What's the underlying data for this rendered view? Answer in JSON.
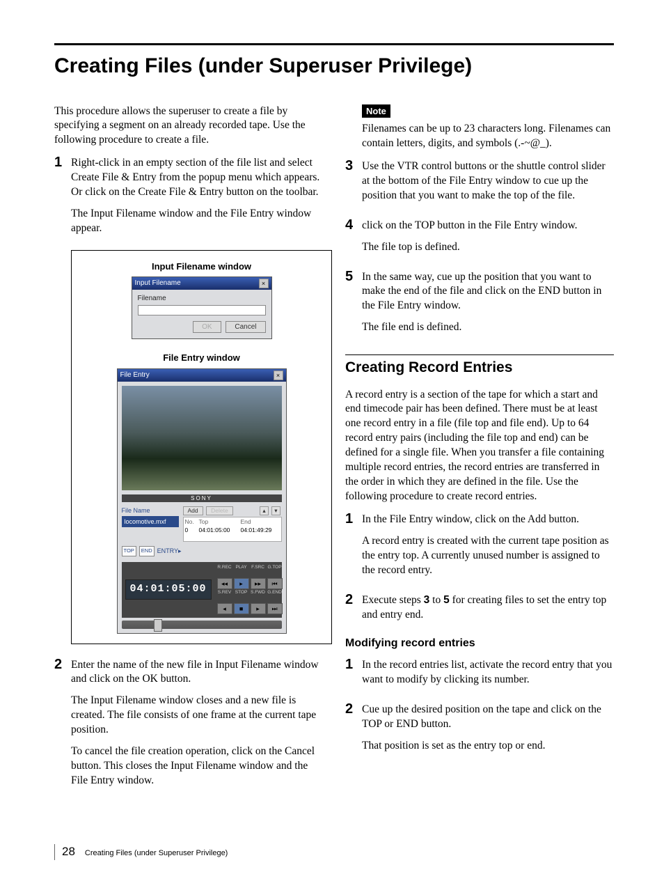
{
  "title": "Creating Files (under Superuser Privilege)",
  "intro": "This procedure allows the superuser to create a file by specifying a segment on an already recorded tape. Use the following procedure to create a file.",
  "left": {
    "step1": {
      "num": "1",
      "p1": "Right-click in an empty section of the file list and select Create File & Entry from the popup menu which appears. Or click on the Create File & Entry button on the toolbar.",
      "p2": "The Input Filename window and the File Entry window appear."
    },
    "fig": {
      "cap1": "Input Filename window",
      "dlg1_title": "Input Filename",
      "dlg1_label": "Filename",
      "dlg1_ok": "OK",
      "dlg1_cancel": "Cancel",
      "cap2": "File Entry  window",
      "dlg2_title": "File Entry",
      "sony": "SONY",
      "file_name_lbl": "File Name",
      "file_name": "locomotive.mxf",
      "add": "Add",
      "delete": "Delete",
      "tbl_no": "No.",
      "tbl_top": "Top",
      "tbl_end": "End",
      "row_no": "0",
      "row_top": "04:01:05:00",
      "row_end": "04:01:49:29",
      "top_btn": "TOP",
      "end_btn": "END",
      "entry_lbl": "ENTRY▸",
      "tc": "04:01:05:00",
      "c_r_rec": "R.REC",
      "c_play": "PLAY",
      "c_fsrc": "F.SRC",
      "c_gtop": "G.TOP",
      "c_srev": "S.REV",
      "c_stop": "STOP",
      "c_sfwd": "S.FWD",
      "c_gend": "G.END"
    },
    "step2": {
      "num": "2",
      "p1": "Enter the name of the new file in Input Filename window and click on the OK button.",
      "p2": "The Input Filename window closes and a new file is created. The file consists of one frame at the current tape position.",
      "p3": "To cancel the file creation operation, click on the Cancel button. This closes the Input Filename window and the File Entry window."
    }
  },
  "right": {
    "note_label": "Note",
    "note_body": "Filenames can be up to 23 characters long. Filenames can contain letters, digits, and symbols (.-~@_).",
    "step3": {
      "num": "3",
      "p1": "Use the VTR control buttons or the shuttle control slider at the bottom of the File Entry window to cue up the position that you want to make the top of the file."
    },
    "step4": {
      "num": "4",
      "p1": "click on the TOP button in the File Entry window.",
      "p2": "The file top is defined."
    },
    "step5": {
      "num": "5",
      "p1": "In the same way, cue up the position that you want to make the end of the file and click on the END button in the File Entry window.",
      "p2": "The file end is defined."
    },
    "sec2_title": "Creating Record Entries",
    "sec2_intro": "A record entry is a section of the tape for which a start and end timecode pair has been defined. There must be at least one record entry in a file (file top and file end).  Up to 64 record entry pairs (including the file top and end) can be defined for a single file. When you transfer a file containing multiple record entries, the record entries are transferred in the order in which they are defined in the file. Use the following procedure to create record entries.",
    "s2_step1": {
      "num": "1",
      "p1": "In the File Entry window, click on the Add button.",
      "p2": "A record entry is created with the current tape position as the entry top. A currently unused number is assigned to the record entry."
    },
    "s2_step2": {
      "num": "2",
      "p1a": "Execute steps ",
      "p1b": "3",
      "p1c": " to ",
      "p1d": "5",
      "p1e": " for creating files to set the entry top and entry end."
    },
    "sub_title": "Modifying record entries",
    "m_step1": {
      "num": "1",
      "p1": "In the record entries list, activate the record entry that you want to modify by clicking its number."
    },
    "m_step2": {
      "num": "2",
      "p1": "Cue up the desired position on the tape and click on the TOP or END button.",
      "p2": "That position is set as the entry top or end."
    }
  },
  "footer": {
    "page": "28",
    "title": "Creating Files (under Superuser Privilege)"
  }
}
